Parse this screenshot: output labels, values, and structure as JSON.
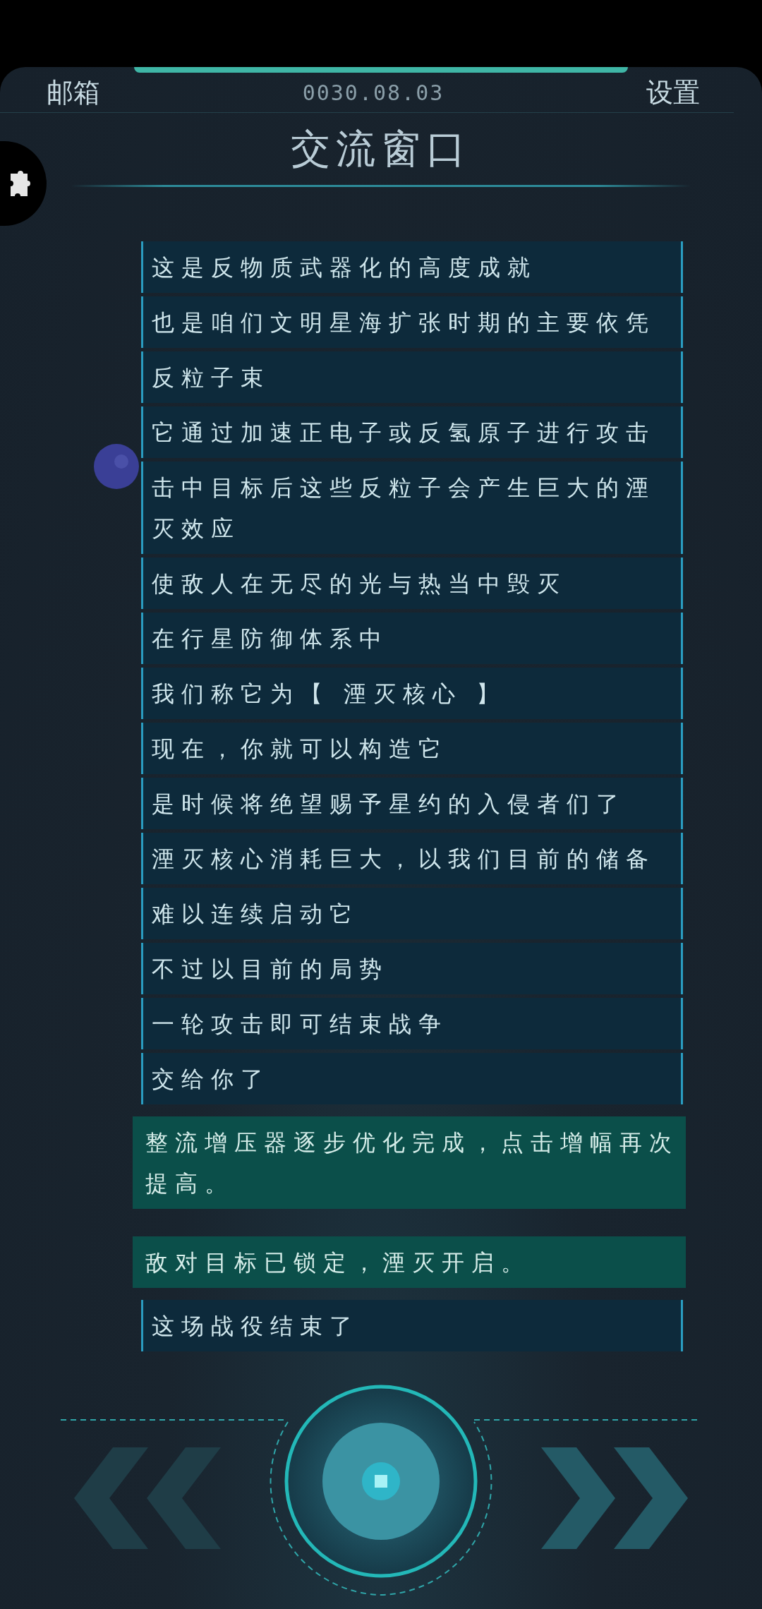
{
  "header": {
    "left_button": "邮箱",
    "date": "0030.08.03",
    "right_button": "设置",
    "title": "交流窗口"
  },
  "messages": [
    {
      "kind": "dialog",
      "text": "这是反物质武器化的高度成就"
    },
    {
      "kind": "dialog",
      "text": "也是咱们文明星海扩张时期的主要依凭"
    },
    {
      "kind": "dialog",
      "text": "反粒子束"
    },
    {
      "kind": "dialog",
      "text": "它通过加速正电子或反氢原子进行攻击"
    },
    {
      "kind": "dialog",
      "text": "击中目标后这些反粒子会产生巨大的湮灭效应"
    },
    {
      "kind": "dialog",
      "text": "使敌人在无尽的光与热当中毁灭"
    },
    {
      "kind": "dialog",
      "text": "在行星防御体系中"
    },
    {
      "kind": "dialog",
      "text": "我们称它为【 湮灭核心 】"
    },
    {
      "kind": "dialog",
      "text": "现在，你就可以构造它"
    },
    {
      "kind": "dialog",
      "text": "是时候将绝望赐予星约的入侵者们了"
    },
    {
      "kind": "dialog",
      "text": "湮灭核心消耗巨大，以我们目前的储备"
    },
    {
      "kind": "dialog",
      "text": "难以连续启动它"
    },
    {
      "kind": "dialog",
      "text": "不过以目前的局势"
    },
    {
      "kind": "dialog",
      "text": "一轮攻击即可结束战争"
    },
    {
      "kind": "dialog",
      "text": "交给你了"
    },
    {
      "kind": "system",
      "text": "整流增压器逐步优化完成，点击增幅再次提高。"
    },
    {
      "kind": "system",
      "text": "敌对目标已锁定，湮灭开启。"
    },
    {
      "kind": "dialog",
      "text": "这场战役结束了"
    }
  ]
}
